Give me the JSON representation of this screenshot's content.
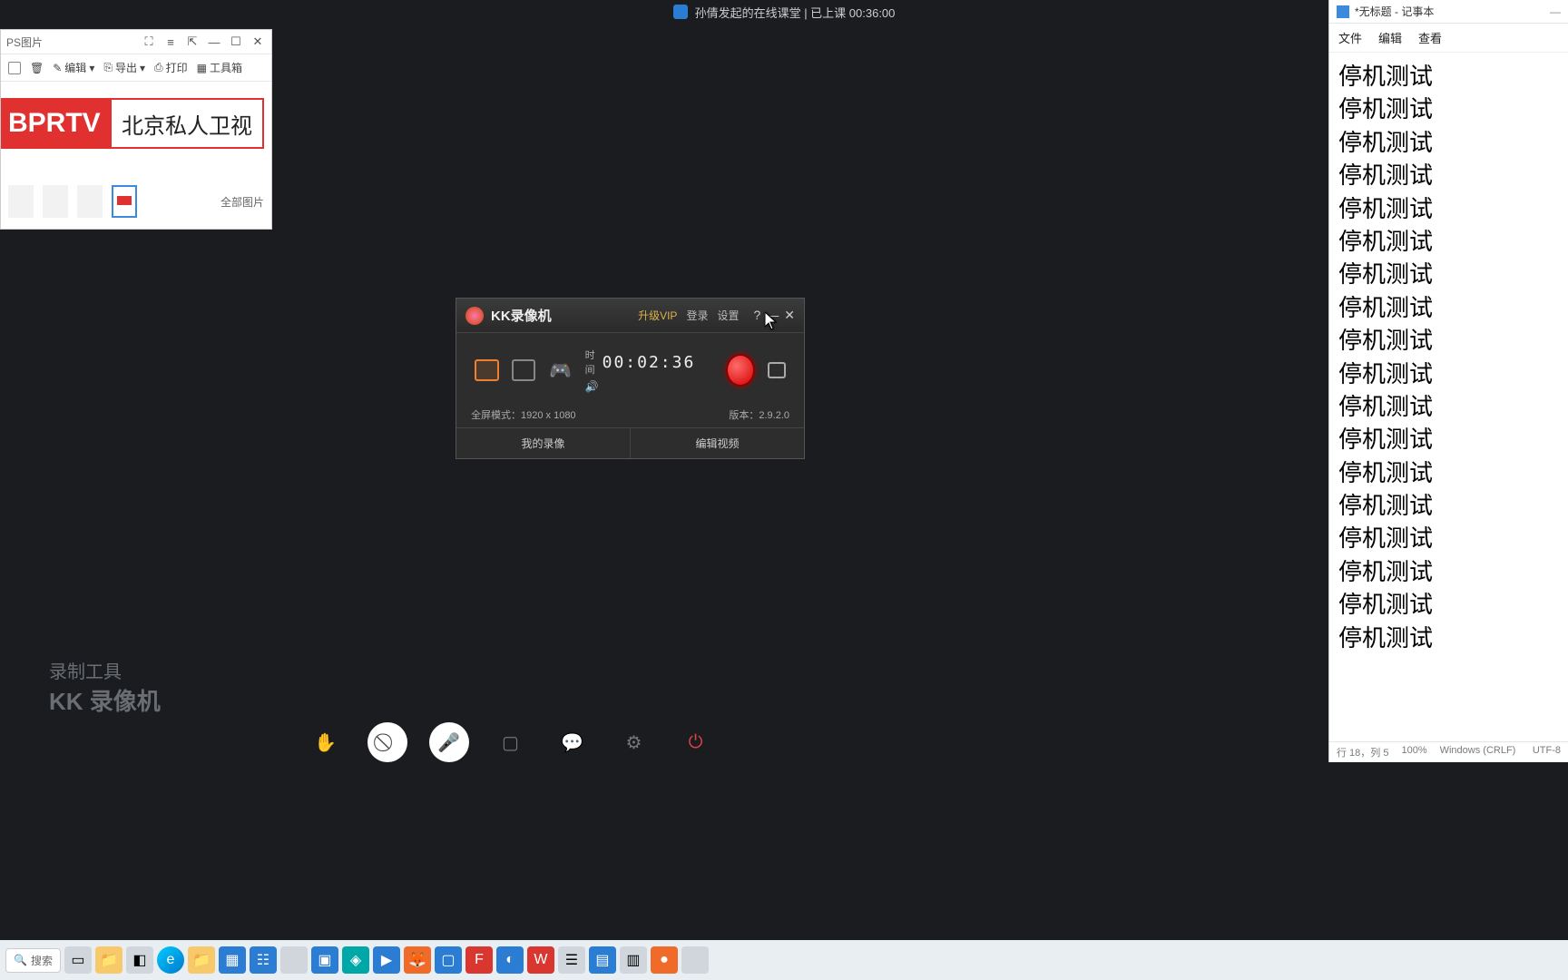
{
  "banner": {
    "text": "孙倩发起的在线课堂 | 已上课 00:36:00"
  },
  "wps": {
    "title": "PS图片",
    "toolbar": {
      "edit": "编辑",
      "export": "导出",
      "print": "打印",
      "tools": "工具箱"
    },
    "logo_red": "BPRTV",
    "logo_text": "北京私人卫视",
    "all_images": "全部图片"
  },
  "kk": {
    "name": "KK录像机",
    "vip": "升级VIP",
    "login": "登录",
    "settings": "设置",
    "time_label": "时间",
    "time": "00:02:36",
    "mode_info": "全屏模式：1920 x 1080",
    "version": "版本：2.9.2.0",
    "my_rec": "我的录像",
    "edit_video": "编辑视频"
  },
  "watermark": {
    "l1": "录制工具",
    "l2": "KK 录像机"
  },
  "meeting": {
    "raise": "举手",
    "camera": "开启视频",
    "mic": "解除静音",
    "share": "共享窗口",
    "chat": "互动消息",
    "set": "设置",
    "leave": "离开课堂"
  },
  "notepad": {
    "title": "*无标题 - 记事本",
    "menu": {
      "file": "文件",
      "edit": "编辑",
      "view": "查看"
    },
    "line": "停机测试",
    "line_count": 18,
    "status": {
      "pos": "行 18，列 5",
      "zoom": "100%",
      "eol": "Windows (CRLF)",
      "enc": "UTF-8"
    }
  },
  "taskbar": {
    "search": "搜索"
  }
}
